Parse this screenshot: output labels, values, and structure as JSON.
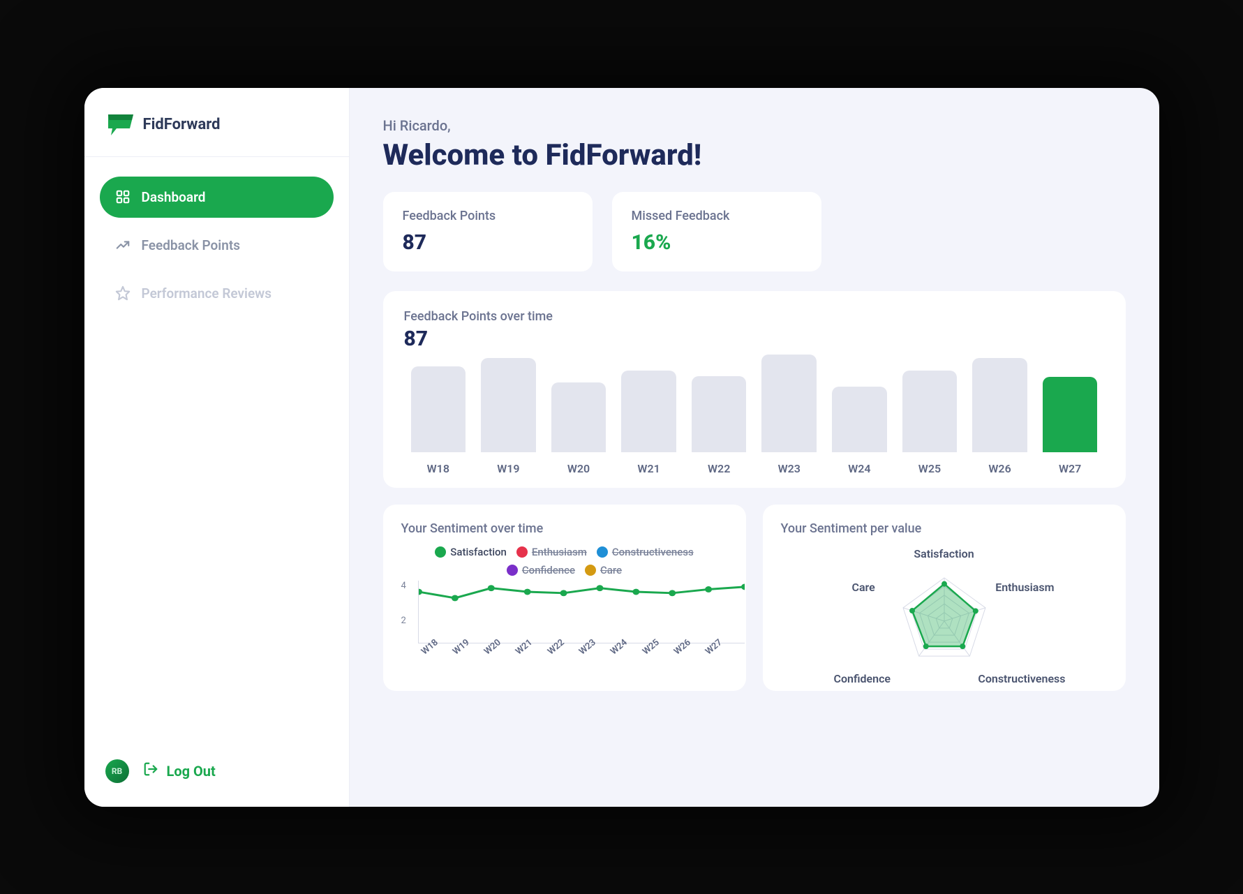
{
  "brand": {
    "name": "FidForward"
  },
  "sidebar": {
    "items": [
      {
        "label": "Dashboard",
        "active": true
      },
      {
        "label": "Feedback Points",
        "active": false
      },
      {
        "label": "Performance Reviews",
        "active": false
      }
    ],
    "avatar_initials": "RB",
    "logout_label": "Log Out"
  },
  "header": {
    "greeting": "Hi Ricardo,",
    "welcome": "Welcome to FidForward!"
  },
  "stats": {
    "feedback_points": {
      "label": "Feedback Points",
      "value": "87"
    },
    "missed_feedback": {
      "label": "Missed Feedback",
      "value": "16%"
    }
  },
  "feedback_over_time": {
    "title": "Feedback Points over time",
    "value": "87"
  },
  "sentiment_over_time": {
    "title": "Your Sentiment over time",
    "yticks": {
      "a": "4",
      "b": "2"
    },
    "legend": {
      "satisfaction": "Satisfaction",
      "enthusiasm": "Enthusiasm",
      "constructiveness": "Constructiveness",
      "confidence": "Confidence",
      "care": "Care"
    }
  },
  "sentiment_per_value": {
    "title": "Your Sentiment per value",
    "labels": {
      "satisfaction": "Satisfaction",
      "enthusiasm": "Enthusiasm",
      "constructiveness": "Constructiveness",
      "confidence": "Confidence",
      "care": "Care"
    }
  },
  "colors": {
    "green": "#1aa84e",
    "red": "#e6324b",
    "blue": "#1f8fd6",
    "purple": "#7a2fc9",
    "gold": "#d49a12"
  },
  "chart_data": [
    {
      "type": "bar",
      "title": "Feedback Points over time",
      "categories": [
        "W18",
        "W19",
        "W20",
        "W21",
        "W22",
        "W23",
        "W24",
        "W25",
        "W26",
        "W27"
      ],
      "values": [
        105,
        115,
        85,
        100,
        93,
        120,
        80,
        100,
        115,
        92
      ],
      "highlight_index": 9,
      "ylabel": "Feedback Points"
    },
    {
      "type": "line",
      "title": "Your Sentiment over time",
      "x": [
        "W18",
        "W19",
        "W20",
        "W21",
        "W22",
        "W23",
        "W24",
        "W25",
        "W26",
        "W27"
      ],
      "ylim": [
        0,
        5
      ],
      "series": [
        {
          "name": "Satisfaction",
          "color": "#1aa84e",
          "visible": true,
          "values": [
            4.1,
            3.6,
            4.4,
            4.1,
            4.0,
            4.4,
            4.1,
            4.0,
            4.3,
            4.5
          ]
        },
        {
          "name": "Enthusiasm",
          "color": "#e6324b",
          "visible": false,
          "values": []
        },
        {
          "name": "Constructiveness",
          "color": "#1f8fd6",
          "visible": false,
          "values": []
        },
        {
          "name": "Confidence",
          "color": "#7a2fc9",
          "visible": false,
          "values": []
        },
        {
          "name": "Care",
          "color": "#d49a12",
          "visible": false,
          "values": []
        }
      ]
    },
    {
      "type": "radar",
      "title": "Your Sentiment per value",
      "axes": [
        "Satisfaction",
        "Enthusiasm",
        "Constructiveness",
        "Confidence",
        "Care"
      ],
      "max": 5,
      "values": [
        4.3,
        3.8,
        3.6,
        3.6,
        3.9
      ]
    }
  ]
}
